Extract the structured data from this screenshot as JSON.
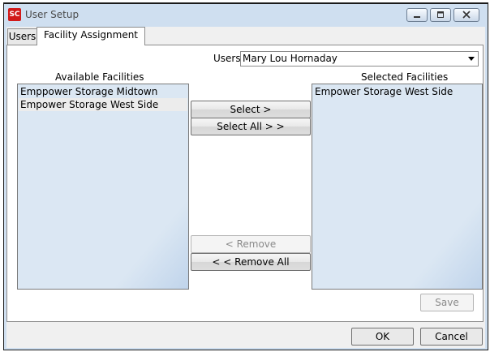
{
  "window": {
    "title": "User Setup",
    "icon_text": "SC"
  },
  "title_buttons": {
    "minimize": "minimize-icon",
    "maximize": "maximize-icon",
    "close": "close-icon"
  },
  "tabs": [
    {
      "label": "Users",
      "active": false
    },
    {
      "label": "Facility Assignment",
      "active": true
    }
  ],
  "users": {
    "label": "Users:",
    "selected": "Mary Lou Hornaday"
  },
  "available": {
    "header": "Available Facilities",
    "items": [
      "Emppower Storage Midtown",
      "Empower Storage West Side"
    ]
  },
  "selected": {
    "header": "Selected Facilities",
    "items": [
      "Empower Storage West Side"
    ]
  },
  "buttons": {
    "select": "Select >",
    "select_all": "Select All > >",
    "remove": "< Remove",
    "remove_all": "< < Remove All",
    "save": "Save",
    "ok": "OK",
    "cancel": "Cancel"
  },
  "colors": {
    "title_frame": "#cfdff0",
    "list_bg": "#dbe7f3",
    "app_icon": "#d11a1a"
  }
}
